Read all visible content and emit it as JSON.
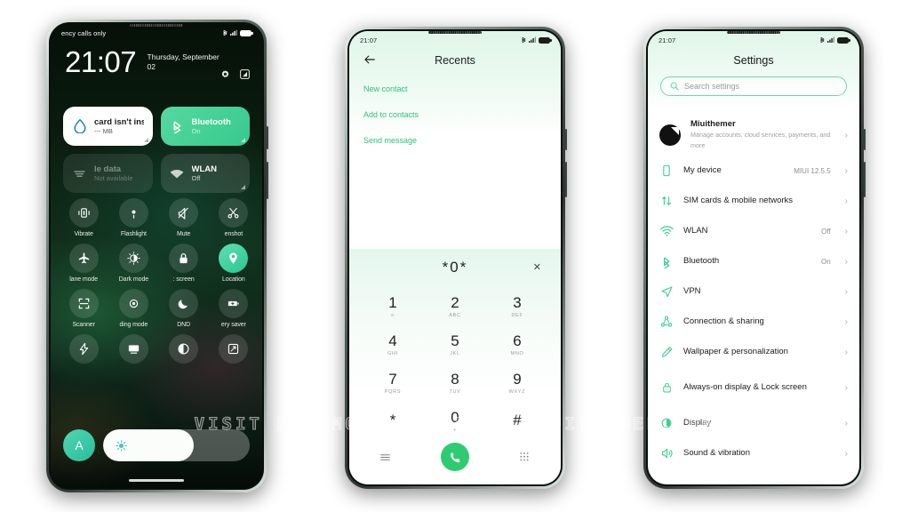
{
  "watermark": "VISIT FOR MORE THEMES - MIUITHEMER.COM",
  "theme": {
    "accent_green": "#2ecc71",
    "tile_on_green": "#2cc495",
    "background_top": "#4fe08a",
    "background_bottom": "#000503"
  },
  "phone1": {
    "name": "control-center",
    "status": {
      "carrier": "ency calls only",
      "time_hidden": "",
      "icons": [
        "bluetooth-icon",
        "signal-icon",
        "battery-icon"
      ]
    },
    "clock": {
      "time": "21:07",
      "date": "Thursday, September 02"
    },
    "top_icons": [
      "settings-gear-icon",
      "screenshot-icon"
    ],
    "cards": [
      {
        "title": "card isn't insta",
        "sub": "--- MB",
        "icon": "data-usage-icon",
        "style": "white"
      },
      {
        "title": "Bluetooth",
        "sub": "On",
        "icon": "bluetooth-icon",
        "style": "green"
      },
      {
        "title": "le data",
        "sub": "Not available",
        "icon": "mobile-data-icon",
        "style": "dim"
      },
      {
        "title": "WLAN",
        "sub": "Off",
        "icon": "wifi-icon",
        "style": "dim2"
      }
    ],
    "tiles": [
      {
        "label": "Vibrate",
        "icon": "vibrate-icon",
        "on": false
      },
      {
        "label": "Flashlight",
        "icon": "flashlight-icon",
        "on": false
      },
      {
        "label": "Mute",
        "icon": "mute-icon",
        "on": false
      },
      {
        "label": "enshot",
        "icon": "scissors-icon",
        "on": false
      },
      {
        "label": "lane mode",
        "icon": "airplane-icon",
        "on": false
      },
      {
        "label": "Dark mode",
        "icon": "dark-mode-icon",
        "on": false
      },
      {
        "label": ": screen",
        "icon": "lock-icon",
        "on": false
      },
      {
        "label": "Location",
        "icon": "location-pin-icon",
        "on": true
      },
      {
        "label": "Scanner",
        "icon": "scanner-icon",
        "on": false
      },
      {
        "label": "ding mode",
        "icon": "reading-mode-icon",
        "on": false
      },
      {
        "label": "DND",
        "icon": "moon-icon",
        "on": false
      },
      {
        "label": "ery saver",
        "icon": "battery-saver-icon",
        "on": false
      },
      {
        "label": "",
        "icon": "lightning-icon",
        "on": false
      },
      {
        "label": "",
        "icon": "cast-icon",
        "on": false
      },
      {
        "label": "",
        "icon": "contrast-icon",
        "on": false
      },
      {
        "label": "",
        "icon": "rotate-icon",
        "on": false
      }
    ],
    "brightness": {
      "auto_label": "A",
      "icon": "brightness-sun-icon",
      "level_percent": 62
    }
  },
  "phone2": {
    "name": "dialer",
    "status": {
      "time": "21:07",
      "icons": [
        "bluetooth-icon",
        "signal-icon",
        "battery-icon"
      ]
    },
    "title": "Recents",
    "back_icon": "back-arrow-icon",
    "actions": [
      "New contact",
      "Add to contacts",
      "Send message"
    ],
    "dialpad": {
      "number": "*0*",
      "clear_icon": "close-x-icon",
      "keys": [
        {
          "digit": "1",
          "letters": "∞"
        },
        {
          "digit": "2",
          "letters": "ABC"
        },
        {
          "digit": "3",
          "letters": "DEF"
        },
        {
          "digit": "4",
          "letters": "GHI"
        },
        {
          "digit": "5",
          "letters": "JKL"
        },
        {
          "digit": "6",
          "letters": "MNO"
        },
        {
          "digit": "7",
          "letters": "PQRS"
        },
        {
          "digit": "8",
          "letters": "TUV"
        },
        {
          "digit": "9",
          "letters": "WXYZ"
        },
        {
          "digit": "*",
          "letters": ""
        },
        {
          "digit": "0",
          "letters": "+"
        },
        {
          "digit": "#",
          "letters": ""
        }
      ]
    },
    "bottom_bar": [
      "menu-icon",
      "call-button",
      "keypad-icon"
    ]
  },
  "phone3": {
    "name": "settings",
    "status": {
      "time": "21:07",
      "icons": [
        "bluetooth-icon",
        "signal-icon",
        "battery-icon"
      ]
    },
    "title": "Settings",
    "search": {
      "placeholder": "Search settings",
      "icon": "search-icon"
    },
    "account": {
      "name": "Miuithemer",
      "sub": "Manage accounts, cloud services, payments, and more",
      "avatar": "account-avatar"
    },
    "items": [
      {
        "label": "My device",
        "value": "MIUI 12.5.5",
        "icon": "phone-icon"
      },
      {
        "label": "SIM cards & mobile networks",
        "value": "",
        "icon": "sim-transfer-icon"
      },
      {
        "label": "WLAN",
        "value": "Off",
        "icon": "wifi-icon"
      },
      {
        "label": "Bluetooth",
        "value": "On",
        "icon": "bluetooth-icon"
      },
      {
        "label": "VPN",
        "value": "",
        "icon": "vpn-icon"
      },
      {
        "label": "Connection & sharing",
        "value": "",
        "icon": "share-nodes-icon"
      },
      {
        "label": "Wallpaper & personalization",
        "value": "",
        "icon": "wallpaper-icon"
      },
      {
        "label": "Always-on display & Lock screen",
        "value": "",
        "icon": "lock-icon"
      },
      {
        "label": "Display",
        "value": "",
        "icon": "display-brightness-icon"
      },
      {
        "label": "Sound & vibration",
        "value": "",
        "icon": "speaker-icon"
      }
    ]
  }
}
